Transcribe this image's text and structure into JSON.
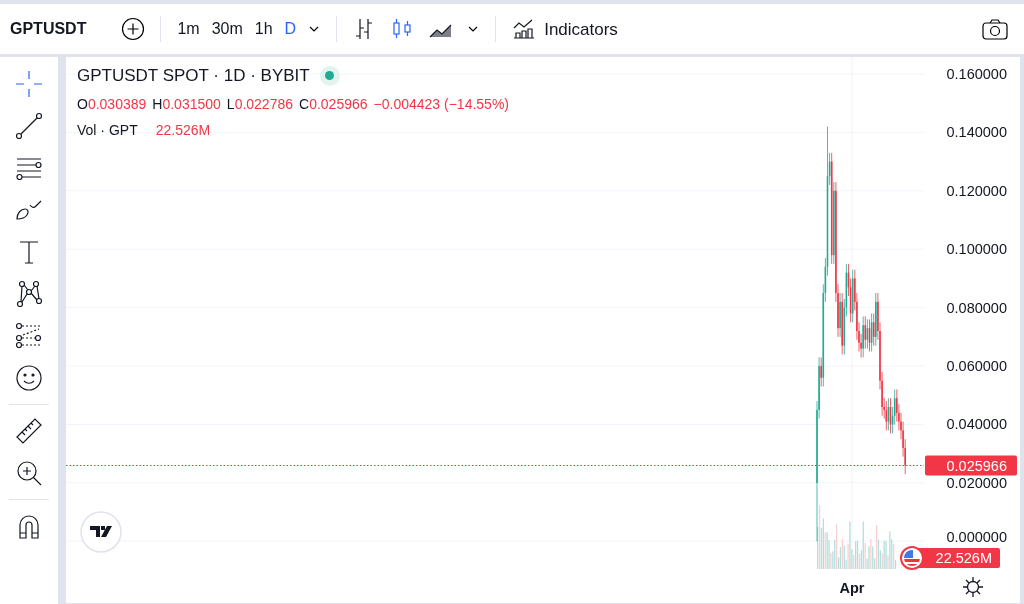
{
  "toolbar": {
    "symbol": "GPTUSDT",
    "intervals": [
      {
        "label": "1m",
        "selected": false
      },
      {
        "label": "30m",
        "selected": false
      },
      {
        "label": "1h",
        "selected": false
      },
      {
        "label": "D",
        "selected": true
      }
    ],
    "chart_types": [
      {
        "kind": "bars",
        "selected": false
      },
      {
        "kind": "candles",
        "selected": true
      },
      {
        "kind": "area",
        "selected": false
      }
    ],
    "indicators_label": "Indicators"
  },
  "drawing_tools": [
    {
      "tools": [
        {
          "kind": "crosshair",
          "selected": true
        },
        {
          "kind": "trend-line",
          "selected": false
        },
        {
          "kind": "fib",
          "selected": false
        },
        {
          "kind": "brush",
          "selected": false
        },
        {
          "kind": "text",
          "selected": false
        },
        {
          "kind": "pattern",
          "selected": false
        },
        {
          "kind": "forecast",
          "selected": false
        },
        {
          "kind": "emoji",
          "selected": false
        }
      ]
    },
    {
      "tools": [
        {
          "kind": "ruler",
          "selected": false
        },
        {
          "kind": "zoom",
          "selected": false
        }
      ]
    },
    {
      "tools": [
        {
          "kind": "magnet",
          "selected": false
        }
      ]
    }
  ],
  "legend": {
    "title": "GPTUSDT SPOT · 1D · BYBIT",
    "market_open": true,
    "ohlc": [
      {
        "label": "O",
        "value": "0.030389"
      },
      {
        "label": "H",
        "value": "0.031500"
      },
      {
        "label": "L",
        "value": "0.022786"
      },
      {
        "label": "C",
        "value": "0.025966"
      }
    ],
    "change": "−0.004423 (−14.55%)",
    "volume_label": "Vol · GPT",
    "volume_value": "22.526M"
  },
  "price_axis": {
    "ticks": [
      "0.160000",
      "0.140000",
      "0.120000",
      "0.100000",
      "0.080000",
      "0.060000",
      "0.040000",
      "0.020000",
      "0.000000"
    ],
    "last_price": "0.025966",
    "last_volume": "22.526M"
  },
  "time_axis": {
    "labels": [
      "Apr"
    ]
  }
}
